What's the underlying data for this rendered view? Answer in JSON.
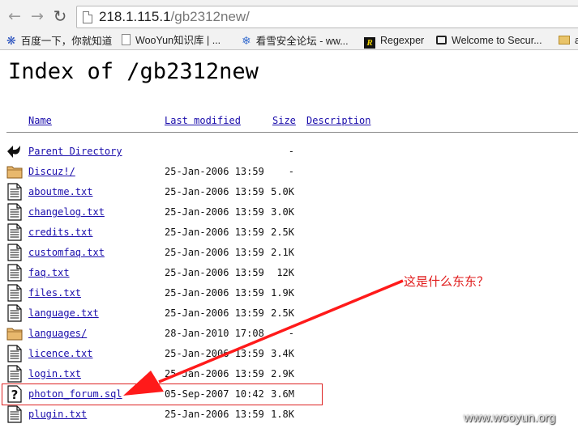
{
  "browser": {
    "url_host": "218.1.115.1",
    "url_path": "/gb2312new/",
    "bookmarks": [
      {
        "label": "百度一下，你就知道",
        "icon": "baidu-paw-icon"
      },
      {
        "label": "WooYun知识库 | ...",
        "icon": "page-icon"
      },
      {
        "label": "看雪安全论坛 - ww...",
        "icon": "snowflake-icon"
      },
      {
        "label": "Regexper",
        "icon": "regexper-icon"
      },
      {
        "label": "Welcome to Secur...",
        "icon": "tv-icon"
      },
      {
        "label": "a",
        "icon": "folder-icon"
      }
    ]
  },
  "page": {
    "title": "Index of /gb2312new",
    "columns": {
      "name": "Name",
      "modified": "Last modified",
      "size": "Size",
      "description": "Description"
    },
    "rows": [
      {
        "name": "Parent Directory",
        "modified": "",
        "size": "-",
        "icon": "back-icon"
      },
      {
        "name": "Discuz!/",
        "modified": "25-Jan-2006 13:59",
        "size": "-",
        "icon": "folder-icon"
      },
      {
        "name": "aboutme.txt",
        "modified": "25-Jan-2006 13:59",
        "size": "5.0K",
        "icon": "text-file-icon"
      },
      {
        "name": "changelog.txt",
        "modified": "25-Jan-2006 13:59",
        "size": "3.0K",
        "icon": "text-file-icon"
      },
      {
        "name": "credits.txt",
        "modified": "25-Jan-2006 13:59",
        "size": "2.5K",
        "icon": "text-file-icon"
      },
      {
        "name": "customfaq.txt",
        "modified": "25-Jan-2006 13:59",
        "size": "2.1K",
        "icon": "text-file-icon"
      },
      {
        "name": "faq.txt",
        "modified": "25-Jan-2006 13:59",
        "size": "12K",
        "icon": "text-file-icon"
      },
      {
        "name": "files.txt",
        "modified": "25-Jan-2006 13:59",
        "size": "1.9K",
        "icon": "text-file-icon"
      },
      {
        "name": "language.txt",
        "modified": "25-Jan-2006 13:59",
        "size": "2.5K",
        "icon": "text-file-icon"
      },
      {
        "name": "languages/",
        "modified": "28-Jan-2010 17:08",
        "size": "-",
        "icon": "folder-icon"
      },
      {
        "name": "licence.txt",
        "modified": "25-Jan-2006 13:59",
        "size": "3.4K",
        "icon": "text-file-icon"
      },
      {
        "name": "login.txt",
        "modified": "25-Jan-2006 13:59",
        "size": "2.9K",
        "icon": "text-file-icon"
      },
      {
        "name": "photon_forum.sql",
        "modified": "05-Sep-2007 10:42",
        "size": "3.6M",
        "icon": "unknown-file-icon"
      },
      {
        "name": "plugin.txt",
        "modified": "25-Jan-2006 13:59",
        "size": "1.8K",
        "icon": "text-file-icon"
      }
    ]
  },
  "annotation": {
    "text": "这是什么东东？",
    "color": "#e01b1b"
  },
  "watermark": "www.wooyun.org"
}
